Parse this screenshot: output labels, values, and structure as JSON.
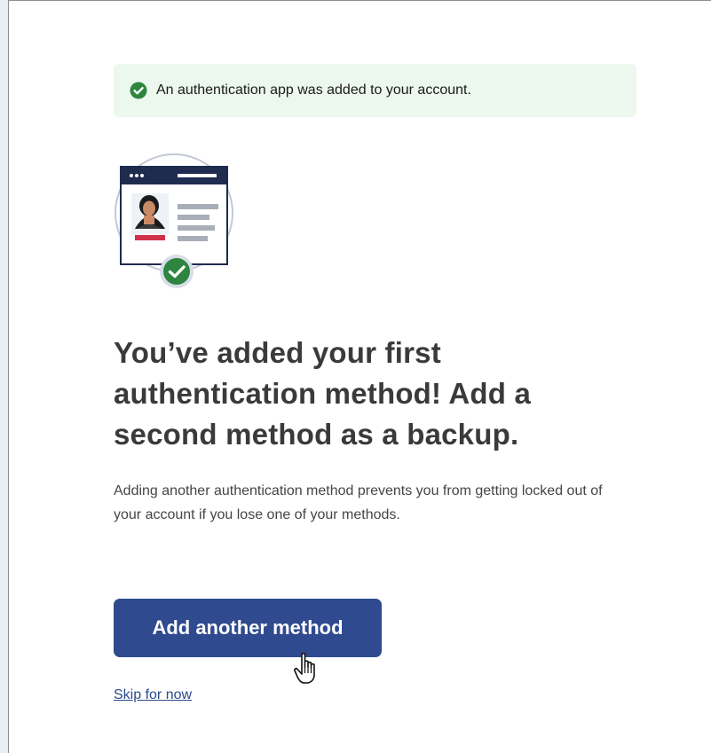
{
  "alert": {
    "icon": "check-circle-icon",
    "message": "An authentication app was added to your account.",
    "color": "#2e8540",
    "background": "#ecf7ee"
  },
  "illustration": {
    "name": "personal-key-id-card-with-success-badge"
  },
  "heading": "You’ve added your first authentication method! Add a second method as a backup.",
  "description": "Adding another authentication method prevents you from getting locked out of your account if you lose one of your methods.",
  "actions": {
    "primary_label": "Add another method",
    "secondary_label": "Skip for now"
  },
  "colors": {
    "primary": "#2f4a8f",
    "link": "#2c4a8c",
    "success": "#2e8540"
  }
}
